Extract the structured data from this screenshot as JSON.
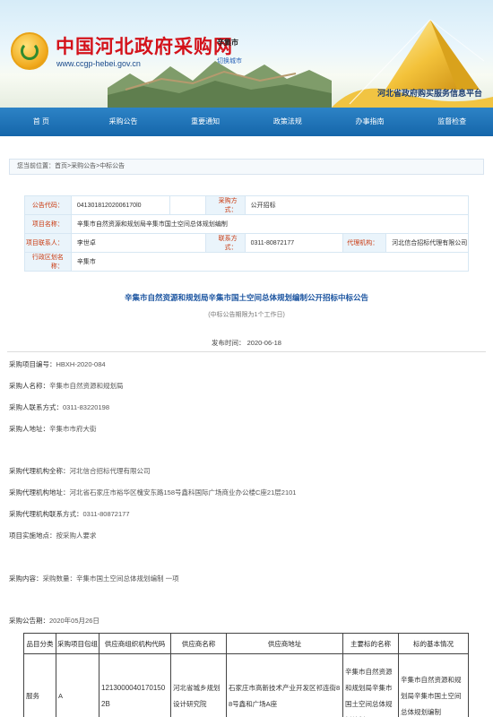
{
  "header": {
    "site_title": "中国河北政府采购网",
    "site_url": "www.ccgp-hebei.gov.cn",
    "city": "辛集市",
    "city_switch": "切换城市",
    "platform": "河北省政府购买服务信息平台"
  },
  "nav": [
    "首 页",
    "采购公告",
    "重要通知",
    "政策法规",
    "办事指南",
    "监督检查"
  ],
  "breadcrumb": {
    "prefix": "您当前位置：",
    "items": [
      "首页",
      "采购公告",
      "中标公告"
    ],
    "sep": ">"
  },
  "info": {
    "notice_code_label": "公告代码：",
    "notice_code": "04130181202006170l0",
    "method_label": "采购方式：",
    "method": "公开招标",
    "project_label": "项目名称：",
    "project": "辛集市自然资源和规划局辛集市国土空间总体规划编制",
    "contact_label": "项目联系人：",
    "contact": "李世卓",
    "phone_label": "联系方式：",
    "phone": "0311-80872177",
    "agency_label": "代理机构：",
    "agency": "河北信合招标代理有限公司",
    "region_label": "行政区划名称：",
    "region": "辛集市"
  },
  "notice": {
    "title": "辛集市自然资源和规划局辛集市国土空间总体规划编制公开招标中标公告",
    "subtitle": "(中标公告期限为1个工作日)",
    "publish_time": "发布时间： 2020-06-18"
  },
  "details": [
    {
      "label": "采购项目编号：",
      "value": "HBXH-2020-084"
    },
    {
      "label": "采购人名称：",
      "value": "辛集市自然资源和规划局"
    },
    {
      "label": "采购人联系方式：",
      "value": "0311-83220198"
    },
    {
      "label": "采购人地址：",
      "value": "辛集市市府大街"
    },
    {
      "label": "采购代理机构全称：",
      "value": "河北信合招标代理有限公司"
    },
    {
      "label": "采购代理机构地址：",
      "value": "河北省石家庄市裕华区槐安东路158号鑫科国际广场商业办公楼C座21层2101"
    },
    {
      "label": "采购代理机构联系方式：",
      "value": "0311-80872177"
    },
    {
      "label": "项目实施地点：",
      "value": "按采购人要求"
    },
    {
      "label": "采购内容：",
      "value": "采购数量：辛集市国土空间总体规划编制 一项"
    },
    {
      "label": "采购公告期：",
      "value": "2020年05月26日"
    }
  ],
  "supplier_table": {
    "headers": [
      "品目分类",
      "采购项目包组",
      "供应商组织机构代码",
      "供应商名称",
      "供应商地址",
      "主要标的名称",
      "标的基本情况"
    ],
    "rows": [
      [
        "服务",
        "A",
        "12130000401701502B",
        "河北省城乡规划设计研究院",
        "石家庄市高新技术产业开发区祁连街88号鑫和广场A座",
        "辛集市自然资源和规划局辛集市国土空间总体规划编制",
        "辛集市自然资源和规划局辛集市国土空间总体规划编制"
      ]
    ]
  },
  "colors": {
    "nav_bg": "#1a6fb4",
    "title_red": "#d4121a",
    "notice_blue": "#1b54a0",
    "label_red": "#c9380e"
  }
}
